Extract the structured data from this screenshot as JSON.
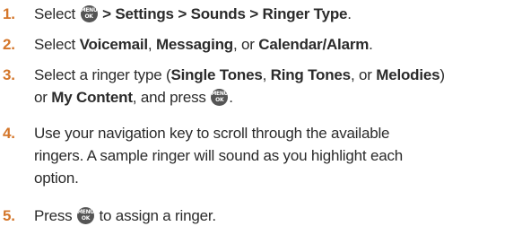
{
  "keys": {
    "menu_top": "MENU",
    "menu_bottom": "OK"
  },
  "colors": {
    "step_number": "#d4762a",
    "text": "#2b2b2b",
    "key_background": "#555555"
  },
  "steps": [
    {
      "number": "1.",
      "parts": [
        {
          "t": "Select "
        },
        {
          "icon": "menu-ok-key-icon"
        },
        {
          "t": " > Settings > Sounds > Ringer Type",
          "b": true
        },
        {
          "t": "."
        }
      ]
    },
    {
      "number": "2.",
      "parts": [
        {
          "t": "Select "
        },
        {
          "t": "Voicemail",
          "b": true
        },
        {
          "t": ", "
        },
        {
          "t": "Messaging",
          "b": true
        },
        {
          "t": ", or "
        },
        {
          "t": "Calendar/Alarm",
          "b": true
        },
        {
          "t": "."
        }
      ]
    },
    {
      "number": "3.",
      "parts": [
        {
          "t": "Select a ringer type ("
        },
        {
          "t": "Single Tones",
          "b": true
        },
        {
          "t": ", "
        },
        {
          "t": "Ring Tones",
          "b": true
        },
        {
          "t": ", or "
        },
        {
          "t": "Melodies",
          "b": true
        },
        {
          "t": ")"
        },
        {
          "br": true
        },
        {
          "t": "or "
        },
        {
          "t": "My Content",
          "b": true
        },
        {
          "t": ", and press "
        },
        {
          "icon": "menu-ok-key-icon"
        },
        {
          "t": "."
        }
      ]
    },
    {
      "number": "4.",
      "parts": [
        {
          "t": "Use your navigation key to scroll through the available"
        },
        {
          "br": true
        },
        {
          "t": "ringers. A sample ringer will sound as you highlight each"
        },
        {
          "br": true
        },
        {
          "t": "option."
        }
      ]
    },
    {
      "number": "5.",
      "parts": [
        {
          "t": "Press "
        },
        {
          "icon": "menu-ok-key-icon"
        },
        {
          "t": " to assign a ringer."
        }
      ]
    }
  ]
}
